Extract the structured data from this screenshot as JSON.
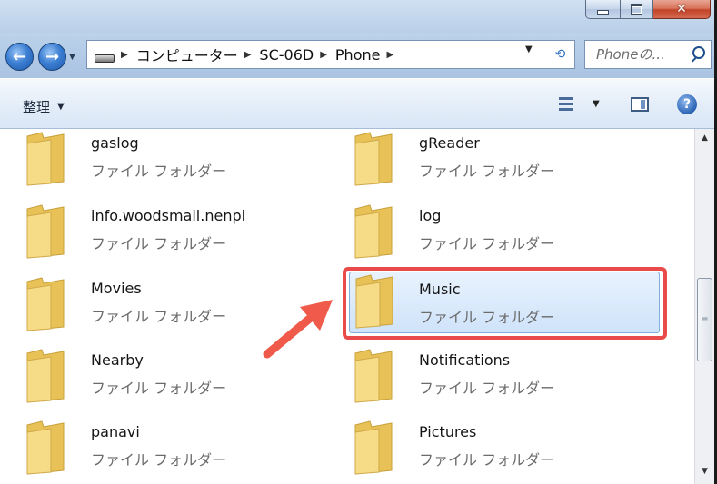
{
  "window": {
    "caption_buttons": [
      {
        "name": "minimize",
        "glyph": ""
      },
      {
        "name": "maximize",
        "glyph": ""
      },
      {
        "name": "close",
        "glyph": "✕"
      }
    ]
  },
  "address": {
    "breadcrumbs": [
      "コンピューター",
      "SC-06D",
      "Phone"
    ],
    "back_glyph": "←",
    "forward_glyph": "→",
    "history_glyph": "▼",
    "dropdown_glyph": "▼",
    "refresh_glyph": "⟲"
  },
  "search": {
    "placeholder": "Phoneの..."
  },
  "commandbar": {
    "organize_label": "整理",
    "organize_caret": "▼",
    "views_caret": "▼",
    "help_label": "?"
  },
  "files": {
    "left": [
      {
        "name": "gaslog",
        "type": "ファイル フォルダー"
      },
      {
        "name": "info.woodsmall.nenpi",
        "type": "ファイル フォルダー"
      },
      {
        "name": "Movies",
        "type": "ファイル フォルダー"
      },
      {
        "name": "Nearby",
        "type": "ファイル フォルダー"
      },
      {
        "name": "panavi",
        "type": "ファイル フォルダー"
      }
    ],
    "right": [
      {
        "name": "gReader",
        "type": "ファイル フォルダー"
      },
      {
        "name": "log",
        "type": "ファイル フォルダー"
      },
      {
        "name": "Music",
        "type": "ファイル フォルダー",
        "selected": true
      },
      {
        "name": "Notifications",
        "type": "ファイル フォルダー"
      },
      {
        "name": "Pictures",
        "type": "ファイル フォルダー"
      }
    ]
  },
  "scrollbar": {
    "up_glyph": "▲",
    "down_glyph": "▼",
    "grip_glyph": "≡"
  },
  "colors": {
    "highlight": "#e94a4a",
    "selection": "#cfe3fa",
    "folder": "#f4d676"
  }
}
